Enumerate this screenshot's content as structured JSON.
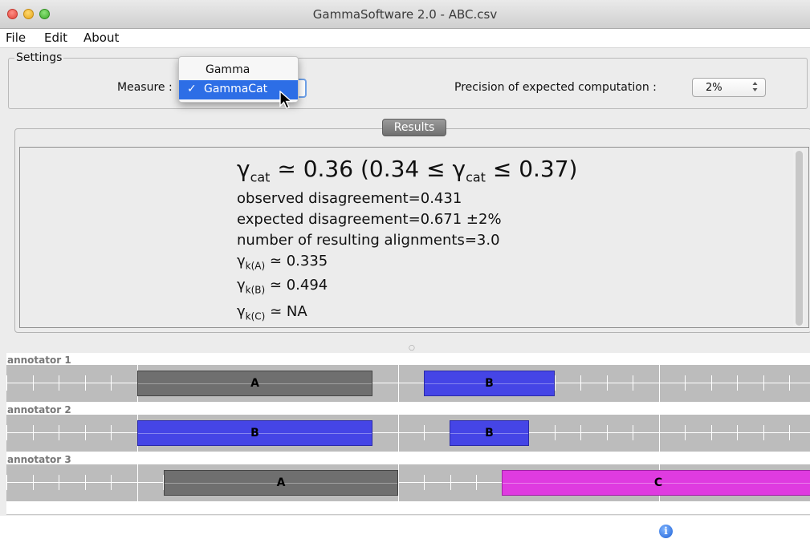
{
  "window": {
    "title": "GammaSoftware 2.0 - ABC.csv"
  },
  "menu": {
    "file": "File",
    "edit": "Edit",
    "about": "About"
  },
  "settings": {
    "title": "Settings",
    "measure_label": "Measure :",
    "measure_options": [
      "Gamma",
      "GammaCat"
    ],
    "measure_selected": "GammaCat",
    "check_mark": "✓",
    "precision_label": "Precision of expected computation :",
    "precision_value": "2%",
    "precision_arrows": "▲▼"
  },
  "results": {
    "tab_label": "Results",
    "gamma_symbol": "γ",
    "cat_sub": "cat",
    "main_approx": " ≃ 0.36 (0.34 ≤ ",
    "main_leq": " ≤ 0.37)",
    "observed": "observed disagreement=0.431",
    "expected": "expected disagreement=0.671 ±2%",
    "alignments": "number of resulting alignments=3.0",
    "k_a_sub": "k(A)",
    "k_a_value": " ≃ 0.335",
    "k_b_sub": "k(B)",
    "k_b_value": " ≃ 0.494",
    "k_c_sub": "k(C)",
    "k_c_value": " ≃ NA"
  },
  "annotators": [
    {
      "name": "annotator 1",
      "units": [
        {
          "label": "A",
          "category": "A"
        },
        {
          "label": "B",
          "category": "B"
        }
      ]
    },
    {
      "name": "annotator 2",
      "units": [
        {
          "label": "B",
          "category": "B"
        },
        {
          "label": "B",
          "category": "B"
        }
      ]
    },
    {
      "name": "annotator 3",
      "units": [
        {
          "label": "A",
          "category": "A"
        },
        {
          "label": "C",
          "category": "C"
        }
      ]
    }
  ],
  "colors": {
    "category_A": "#6f6f6f",
    "category_B": "#4545e6",
    "category_C": "#df3be0",
    "selection": "#2d6ee6"
  },
  "status": {
    "info_icon": "i"
  }
}
